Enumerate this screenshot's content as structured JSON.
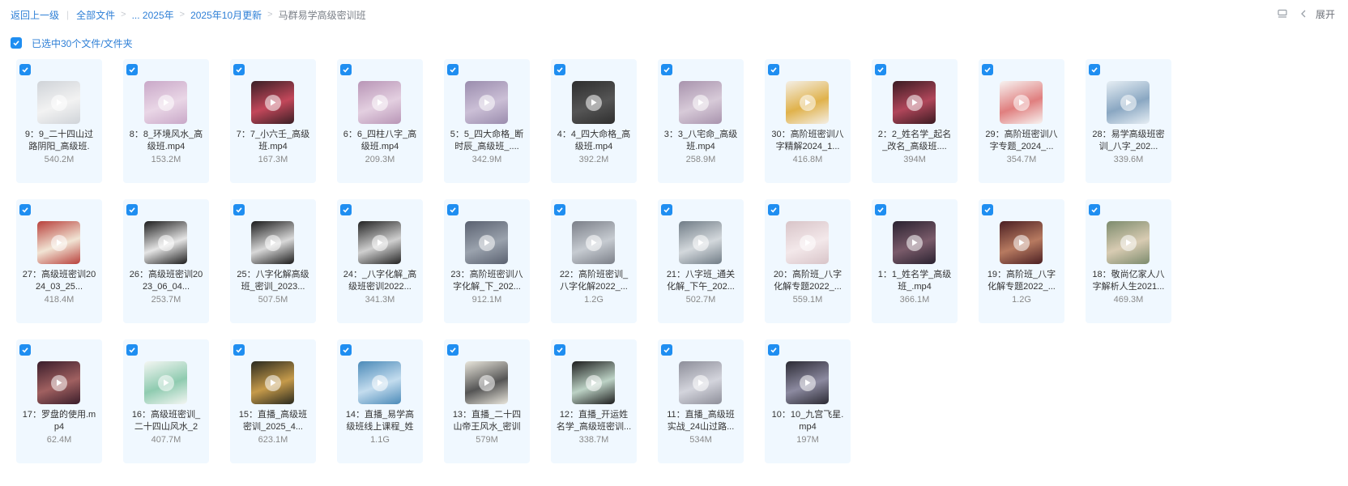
{
  "breadcrumb": {
    "back": "返回上一级",
    "all_files": "全部文件",
    "ellipsis_2025": "... 2025年",
    "oct_update": "2025年10月更新",
    "current": "马群易学高级密训班"
  },
  "toolbar": {
    "expand": "展开"
  },
  "selection": {
    "text": "已选中30个文件/文件夹"
  },
  "icons": {
    "check": "check-icon",
    "play": "play-icon",
    "list": "list-icon",
    "chevron": "chevron-left-icon"
  },
  "colors": {
    "accent": "#1f8ef1",
    "link": "#2e7fd6",
    "card_bg": "#f0f8ff"
  },
  "files": [
    {
      "name": "9：9_二十四山过路阴阳_高级班.",
      "size": "540.2M"
    },
    {
      "name": "8：8_环境风水_高级班.mp4",
      "size": "153.2M"
    },
    {
      "name": "7：7_小六壬_高级班.mp4",
      "size": "167.3M"
    },
    {
      "name": "6：6_四柱八字_高级班.mp4",
      "size": "209.3M"
    },
    {
      "name": "5：5_四大命格_断时辰_高级班_....",
      "size": "342.9M"
    },
    {
      "name": "4：4_四大命格_高级班.mp4",
      "size": "392.2M"
    },
    {
      "name": "3：3_八宅命_高级班.mp4",
      "size": "258.9M"
    },
    {
      "name": "30：高阶班密训八字精解2024_1...",
      "size": "416.8M"
    },
    {
      "name": "2：2_姓名学_起名_改名_高级班....",
      "size": "394M"
    },
    {
      "name": "29：高阶班密训八字专题_2024_...",
      "size": "354.7M"
    },
    {
      "name": "28：易学高级班密训_八字_202...",
      "size": "339.6M"
    },
    {
      "name": "27：高级班密训2024_03_25...",
      "size": "418.4M"
    },
    {
      "name": "26：高级班密训2023_06_04...",
      "size": "253.7M"
    },
    {
      "name": "25：八字化解高级班_密训_2023...",
      "size": "507.5M"
    },
    {
      "name": "24：_八字化解_高级班密训2022...",
      "size": "341.3M"
    },
    {
      "name": "23：高阶班密训八字化解_下_202...",
      "size": "912.1M"
    },
    {
      "name": "22：高阶班密训_八字化解2022_...",
      "size": "1.2G"
    },
    {
      "name": "21：八字班_通关化解_下午_202...",
      "size": "502.7M"
    },
    {
      "name": "20：高阶班_八字化解专题2022_...",
      "size": "559.1M"
    },
    {
      "name": "1：1_姓名学_高级班_.mp4",
      "size": "366.1M"
    },
    {
      "name": "19：高阶班_八字化解专题2022_...",
      "size": "1.2G"
    },
    {
      "name": "18：敬尚亿家人八字解析人生2021...",
      "size": "469.3M"
    },
    {
      "name": "17：罗盘的使用.mp4",
      "size": "62.4M"
    },
    {
      "name": "16：高级班密训_二十四山风水_2",
      "size": "407.7M"
    },
    {
      "name": "15：直播_高级班密训_2025_4...",
      "size": "623.1M"
    },
    {
      "name": "14：直播_易学高级班线上课程_姓",
      "size": "1.1G"
    },
    {
      "name": "13：直播_二十四山帝王风水_密训",
      "size": "579M"
    },
    {
      "name": "12：直播_开运姓名学_高级班密训...",
      "size": "338.7M"
    },
    {
      "name": "11：直播_高级班实战_24山过路...",
      "size": "534M"
    },
    {
      "name": "10：10_九宫飞星.mp4",
      "size": "197M"
    }
  ]
}
